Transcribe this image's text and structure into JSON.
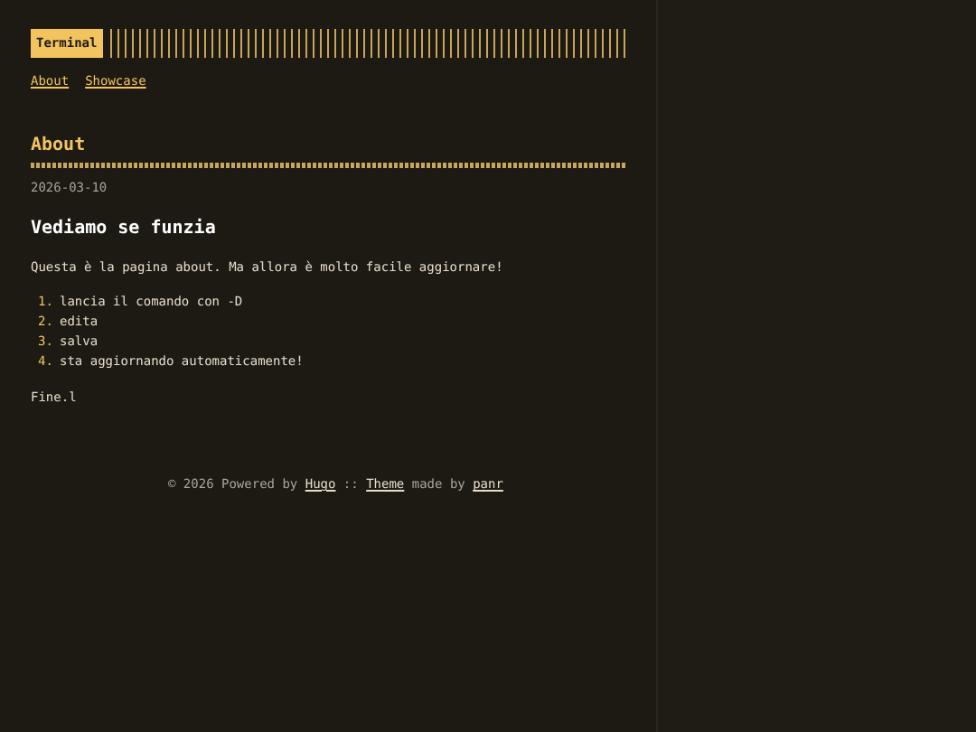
{
  "logo": "Terminal",
  "menu": [
    {
      "label": "About"
    },
    {
      "label": "Showcase"
    }
  ],
  "post": {
    "title": "About",
    "date": "2026-03-10",
    "heading": "Vediamo se funzia",
    "intro": "Questa è la pagina about. Ma allora è molto facile aggiornare!",
    "steps": [
      {
        "number": "1.",
        "text": "lancia il comando con -D"
      },
      {
        "number": "2.",
        "text": "edita"
      },
      {
        "number": "3.",
        "text": "salva"
      },
      {
        "number": "4.",
        "text": "sta aggiornando automaticamente!"
      }
    ],
    "outro": "Fine.l"
  },
  "footer": [
    {
      "kind": "text",
      "text": "© 2026 Powered by "
    },
    {
      "kind": "link",
      "text": "Hugo"
    },
    {
      "kind": "text",
      "text": " :: "
    },
    {
      "kind": "link",
      "text": "Theme"
    },
    {
      "kind": "text",
      "text": " made by "
    },
    {
      "kind": "link",
      "text": "panr"
    }
  ]
}
